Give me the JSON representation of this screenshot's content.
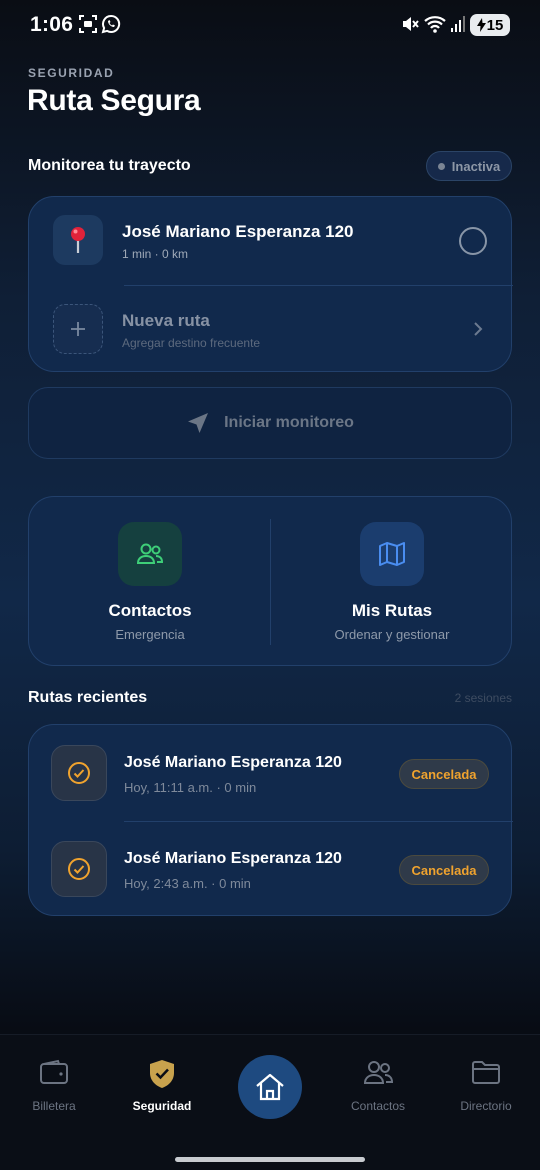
{
  "status_bar": {
    "time": "1:06",
    "battery": "15",
    "icons": [
      "screenshot-icon",
      "whatsapp-icon",
      "mute-icon",
      "wifi-icon",
      "signal-icon",
      "battery-charging-icon"
    ]
  },
  "header": {
    "kicker": "SEGURIDAD",
    "title": "Ruta Segura"
  },
  "monitor": {
    "heading": "Monitorea tu trayecto",
    "status": "Inactiva",
    "routes": [
      {
        "title": "José Mariano Esperanza 120",
        "subtitle": "1 min · 0 km",
        "icon": "map-pin-icon"
      },
      {
        "title": "Nueva ruta",
        "subtitle": "Agregar destino frecuente",
        "icon": "plus-icon"
      }
    ],
    "start_label": "Iniciar monitoreo"
  },
  "actions": [
    {
      "label": "Contactos",
      "sub": "Emergencia",
      "icon": "people-icon",
      "color": "#3ecf78"
    },
    {
      "label": "Mis Rutas",
      "sub": "Ordenar y gestionar",
      "icon": "map-icon",
      "color": "#4a8df0"
    }
  ],
  "recent": {
    "heading": "Rutas recientes",
    "count_label": "2 sesiones",
    "items": [
      {
        "title": "José Mariano Esperanza 120",
        "meta": "Hoy, 11:11 a.m. · 0 min",
        "status": "Cancelada"
      },
      {
        "title": "José Mariano Esperanza 120",
        "meta": "Hoy, 2:43 a.m. · 0 min",
        "status": "Cancelada"
      }
    ]
  },
  "colors": {
    "accent_orange": "#f0a32e",
    "card_bg": "#11294c",
    "home_button": "#1e4a80",
    "shield_gold": "#c8a24d"
  },
  "nav": {
    "items": [
      {
        "label": "Billetera",
        "icon": "wallet-icon"
      },
      {
        "label": "Seguridad",
        "icon": "shield-check-icon"
      },
      {
        "label": "",
        "icon": "home-icon"
      },
      {
        "label": "Contactos",
        "icon": "people-icon"
      },
      {
        "label": "Directorio",
        "icon": "folder-icon"
      }
    ]
  }
}
